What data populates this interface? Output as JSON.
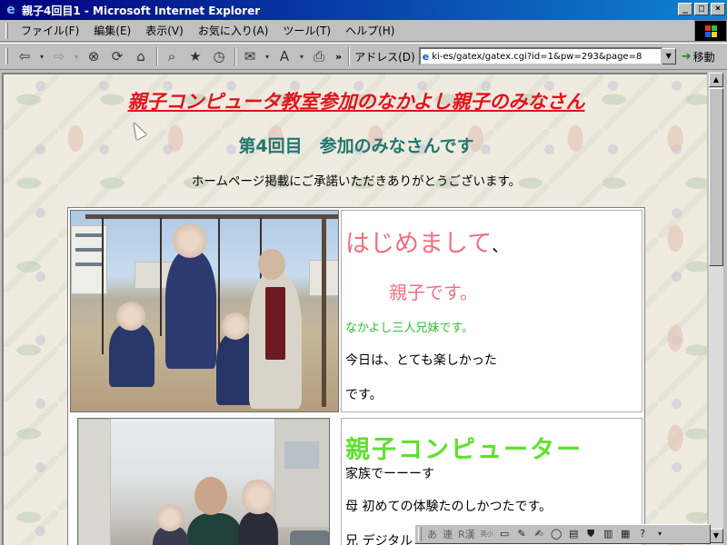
{
  "window": {
    "title": "親子4回目1 - Microsoft Internet Explorer",
    "controls": [
      "_",
      "□",
      "×"
    ]
  },
  "menu": [
    "ファイル(F)",
    "編集(E)",
    "表示(V)",
    "お気に入り(A)",
    "ツール(T)",
    "ヘルプ(H)"
  ],
  "toolbar": {
    "address_label": "アドレス(D)",
    "address_value": "ki-es/gatex/gatex.cgi?id=1&pw=293&page=8",
    "go_label": "移動",
    "more": "»"
  },
  "page": {
    "heading1": "親子コンピュータ教室参加のなかよし親子のみなさん",
    "heading2": "第4回目　参加のみなさんです",
    "thanks": "ホームページ掲載にご承諾いただきありがとうございます。"
  },
  "rows": [
    {
      "greeting_a": "はじめまして",
      "greeting_b": "、",
      "family": "親子です。",
      "siblings": "なかよし三人兄妹です。",
      "today": "今日は、とても楽しかった",
      "desu": "です。"
    },
    {
      "title": "親子コンピューター",
      "line1": "家族でーーーす",
      "line2": "母 初めての体験たのしかつたです。",
      "line3": "兄 デジタル"
    }
  ],
  "ime": {
    "keys": [
      "あ",
      "連",
      "R漢",
      "英小"
    ]
  }
}
